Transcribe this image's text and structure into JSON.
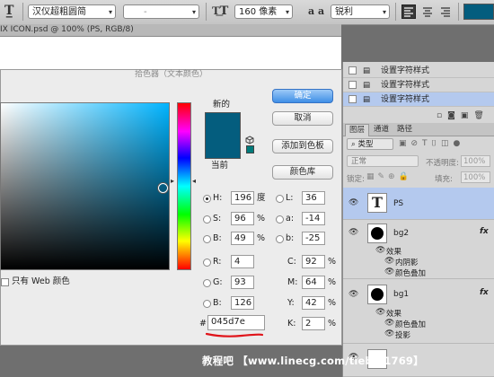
{
  "options_bar": {
    "tool_icon": "text-tool-icon",
    "font_family": "汉仪超粗圆简",
    "font_style": "-",
    "size_icon": "font-size-icon",
    "font_size": "160 像素",
    "aa_icon": "anti-alias-icon",
    "aa_label": "a a",
    "anti_alias": "锐利",
    "text_color": "#045d7e"
  },
  "document": {
    "tab_title": "IX ICON.psd @ 100% (PS, RGB/8)"
  },
  "color_picker": {
    "title": "拾色器（文本颜色）",
    "new_label": "新的",
    "current_label": "当前",
    "new_color": "#045d7e",
    "current_color": "#045d7e",
    "buttons": {
      "ok": "确定",
      "cancel": "取消",
      "add_swatch": "添加到色板",
      "libraries": "颜色库"
    },
    "web_only_label": "只有 Web 颜色",
    "web_only_checked": false,
    "fields": {
      "H": {
        "label": "H:",
        "value": "196",
        "unit": "度"
      },
      "S": {
        "label": "S:",
        "value": "96",
        "unit": "%"
      },
      "B": {
        "label": "B:",
        "value": "49",
        "unit": "%"
      },
      "R": {
        "label": "R:",
        "value": "4"
      },
      "G": {
        "label": "G:",
        "value": "93"
      },
      "Bl": {
        "label": "B:",
        "value": "126"
      },
      "L": {
        "label": "L:",
        "value": "36"
      },
      "a": {
        "label": "a:",
        "value": "-14"
      },
      "b": {
        "label": "b:",
        "value": "-25"
      },
      "C": {
        "label": "C:",
        "value": "92",
        "unit": "%"
      },
      "M": {
        "label": "M:",
        "value": "64",
        "unit": "%"
      },
      "Y": {
        "label": "Y:",
        "value": "42",
        "unit": "%"
      },
      "K": {
        "label": "K:",
        "value": "2",
        "unit": "%"
      }
    },
    "selected_field": "H",
    "hex_label": "#",
    "hex_value": "045d7e"
  },
  "history": {
    "items": [
      {
        "label": "设置字符样式",
        "selected": false
      },
      {
        "label": "设置字符样式",
        "selected": false
      },
      {
        "label": "设置字符样式",
        "selected": true
      }
    ]
  },
  "layers_panel": {
    "tabs": [
      "图层",
      "通道",
      "路径"
    ],
    "active_tab": "图层",
    "filter_label": "类型",
    "blend_mode": "正常",
    "opacity_label": "不透明度:",
    "opacity_value": "100%",
    "lock_label": "锁定:",
    "fill_label": "填充:",
    "fill_value": "100%",
    "layers": [
      {
        "name": "PS",
        "type": "text",
        "selected": true
      },
      {
        "name": "bg2",
        "type": "shape",
        "fx": "fx",
        "effects_label": "效果",
        "effects": [
          "内阴影",
          "颜色叠加"
        ]
      },
      {
        "name": "bg1",
        "type": "shape",
        "fx": "fx",
        "effects_label": "效果",
        "effects": [
          "颜色叠加",
          "投影"
        ]
      }
    ]
  },
  "watermark": "教程吧 【www.linecg.com/tieba/1769】"
}
